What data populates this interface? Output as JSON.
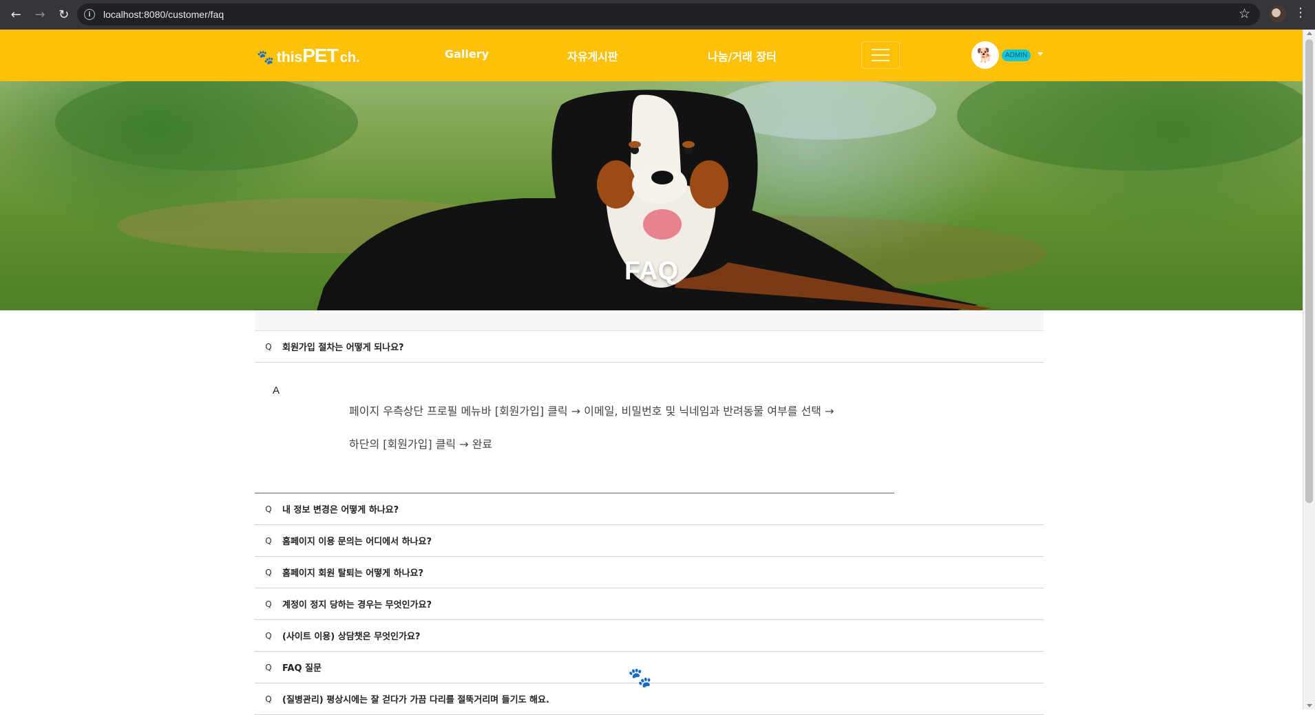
{
  "browser": {
    "url": "localhost:8080/customer/faq",
    "back_icon": "arrow-left-icon",
    "forward_icon": "arrow-right-icon",
    "reload_icon": "reload-icon"
  },
  "navbar": {
    "brand_thisText": "this",
    "brand_petText": "PET",
    "brand_chText": "ch.",
    "links": [
      "Gallery",
      "자유게시판",
      "나눔/거래 장터"
    ],
    "admin_badge": "ADMIN",
    "accent_color": "#ffc107"
  },
  "hero": {
    "title": "FAQ"
  },
  "faq": {
    "items": [
      {
        "question": "회원가입 절차는 어떻게 되나요?"
      },
      {
        "question": "내 정보 변경은 어떻게 하나요?"
      },
      {
        "question": "홈페이지 이용 문의는 어디에서 하나요?"
      },
      {
        "question": "홈페이지 회원 탈퇴는 어떻게 하나요?"
      },
      {
        "question": "계정이 정지 당하는 경우는 무엇인가요?"
      },
      {
        "question": "(사이트 이용) 상담챗은 무엇인가요?"
      },
      {
        "question": "FAQ 질문"
      },
      {
        "question": "(질병관리) 평상시에는 잘 걷다가 가끔 다리를 절뚝거리며 들기도 해요."
      }
    ],
    "open_answer": {
      "label": "A",
      "line1": "페이지 우측상단 프로필 메뉴바 [회원가입] 클릭 → 이메일, 비밀번호 및 닉네임과 반려동물 여부를 선택 →",
      "line2": "하단의 [회원가입] 클릭 → 완료"
    }
  }
}
